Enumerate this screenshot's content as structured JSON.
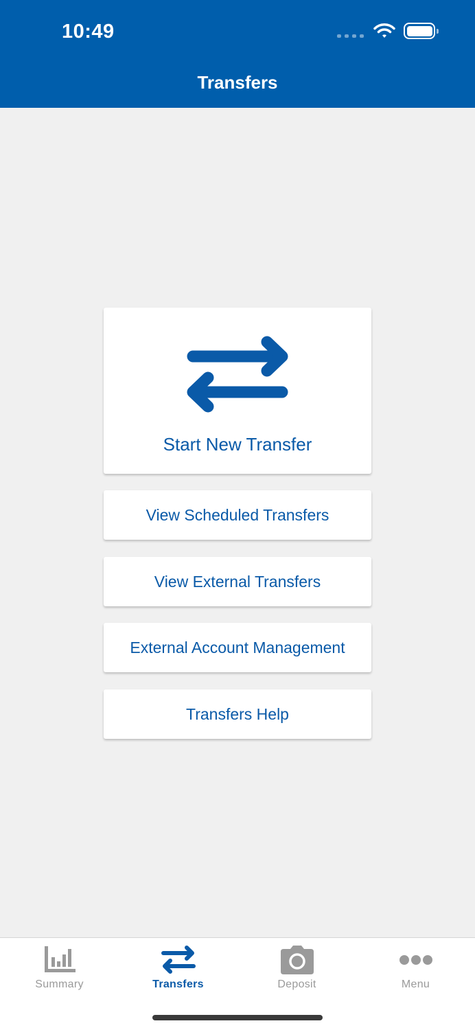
{
  "status_bar": {
    "time": "10:49"
  },
  "header": {
    "title": "Transfers"
  },
  "actions": {
    "start_new_transfer": "Start New Transfer",
    "view_scheduled_transfers": "View Scheduled Transfers",
    "view_external_transfers": "View External Transfers",
    "external_account_management": "External Account Management",
    "transfers_help": "Transfers Help"
  },
  "tabs": [
    {
      "label": "Summary",
      "icon": "bar-chart-icon",
      "active": false
    },
    {
      "label": "Transfers",
      "icon": "transfer-arrows-icon",
      "active": true
    },
    {
      "label": "Deposit",
      "icon": "camera-icon",
      "active": false
    },
    {
      "label": "Menu",
      "icon": "more-dots-icon",
      "active": false
    }
  ],
  "colors": {
    "header_bg": "#005eac",
    "accent": "#0a5aa8",
    "page_bg": "#f0f0f0",
    "inactive_tab": "#9a9a9a"
  }
}
